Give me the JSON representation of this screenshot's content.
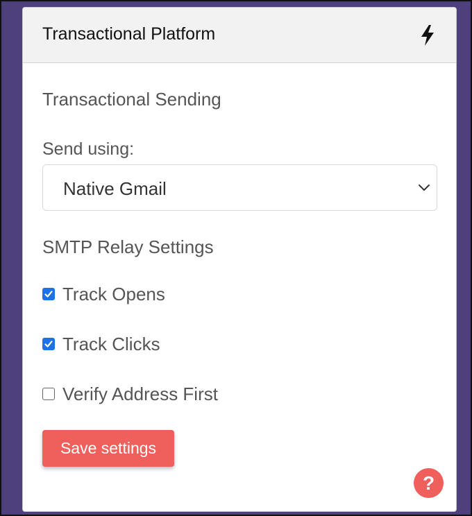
{
  "panel": {
    "title": "Transactional Platform",
    "header_icon": "bolt-icon"
  },
  "transactional": {
    "section_title": "Transactional Sending",
    "send_label": "Send using:",
    "selected_option": "Native Gmail",
    "dropdown_icon": "chevron-down-icon"
  },
  "smtp": {
    "section_title": "SMTP Relay Settings",
    "options": [
      {
        "label": "Track Opens",
        "checked": true
      },
      {
        "label": "Track Clicks",
        "checked": true
      },
      {
        "label": "Verify Address First",
        "checked": false
      }
    ]
  },
  "actions": {
    "save_label": "Save settings",
    "help_label": "?"
  },
  "colors": {
    "background": "#4e3f7d",
    "accent": "#ef5f5c",
    "checkbox": "#1a73e8"
  }
}
